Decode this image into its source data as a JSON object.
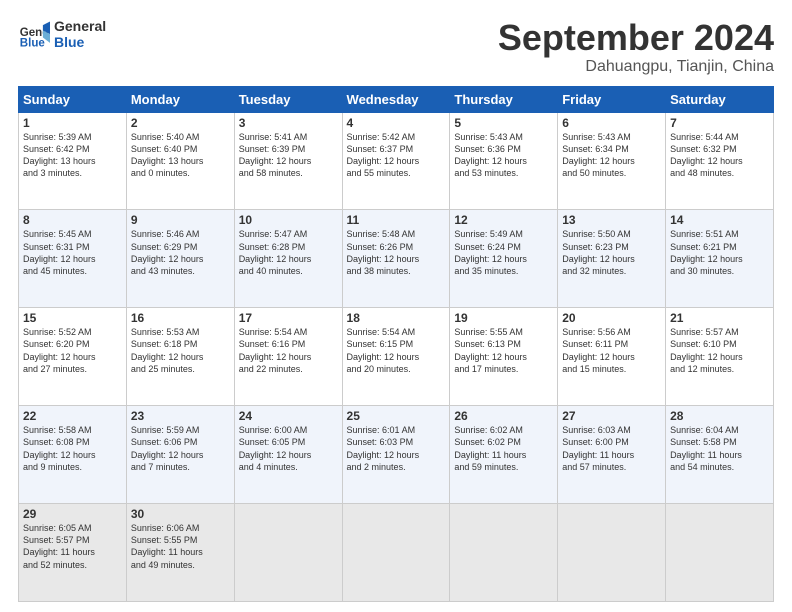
{
  "logo": {
    "line1": "General",
    "line2": "Blue"
  },
  "title": "September 2024",
  "location": "Dahuangpu, Tianjin, China",
  "days_header": [
    "Sunday",
    "Monday",
    "Tuesday",
    "Wednesday",
    "Thursday",
    "Friday",
    "Saturday"
  ],
  "weeks": [
    [
      {
        "day": "1",
        "info": "Sunrise: 5:39 AM\nSunset: 6:42 PM\nDaylight: 13 hours\nand 3 minutes."
      },
      {
        "day": "2",
        "info": "Sunrise: 5:40 AM\nSunset: 6:40 PM\nDaylight: 13 hours\nand 0 minutes."
      },
      {
        "day": "3",
        "info": "Sunrise: 5:41 AM\nSunset: 6:39 PM\nDaylight: 12 hours\nand 58 minutes."
      },
      {
        "day": "4",
        "info": "Sunrise: 5:42 AM\nSunset: 6:37 PM\nDaylight: 12 hours\nand 55 minutes."
      },
      {
        "day": "5",
        "info": "Sunrise: 5:43 AM\nSunset: 6:36 PM\nDaylight: 12 hours\nand 53 minutes."
      },
      {
        "day": "6",
        "info": "Sunrise: 5:43 AM\nSunset: 6:34 PM\nDaylight: 12 hours\nand 50 minutes."
      },
      {
        "day": "7",
        "info": "Sunrise: 5:44 AM\nSunset: 6:32 PM\nDaylight: 12 hours\nand 48 minutes."
      }
    ],
    [
      {
        "day": "8",
        "info": "Sunrise: 5:45 AM\nSunset: 6:31 PM\nDaylight: 12 hours\nand 45 minutes."
      },
      {
        "day": "9",
        "info": "Sunrise: 5:46 AM\nSunset: 6:29 PM\nDaylight: 12 hours\nand 43 minutes."
      },
      {
        "day": "10",
        "info": "Sunrise: 5:47 AM\nSunset: 6:28 PM\nDaylight: 12 hours\nand 40 minutes."
      },
      {
        "day": "11",
        "info": "Sunrise: 5:48 AM\nSunset: 6:26 PM\nDaylight: 12 hours\nand 38 minutes."
      },
      {
        "day": "12",
        "info": "Sunrise: 5:49 AM\nSunset: 6:24 PM\nDaylight: 12 hours\nand 35 minutes."
      },
      {
        "day": "13",
        "info": "Sunrise: 5:50 AM\nSunset: 6:23 PM\nDaylight: 12 hours\nand 32 minutes."
      },
      {
        "day": "14",
        "info": "Sunrise: 5:51 AM\nSunset: 6:21 PM\nDaylight: 12 hours\nand 30 minutes."
      }
    ],
    [
      {
        "day": "15",
        "info": "Sunrise: 5:52 AM\nSunset: 6:20 PM\nDaylight: 12 hours\nand 27 minutes."
      },
      {
        "day": "16",
        "info": "Sunrise: 5:53 AM\nSunset: 6:18 PM\nDaylight: 12 hours\nand 25 minutes."
      },
      {
        "day": "17",
        "info": "Sunrise: 5:54 AM\nSunset: 6:16 PM\nDaylight: 12 hours\nand 22 minutes."
      },
      {
        "day": "18",
        "info": "Sunrise: 5:54 AM\nSunset: 6:15 PM\nDaylight: 12 hours\nand 20 minutes."
      },
      {
        "day": "19",
        "info": "Sunrise: 5:55 AM\nSunset: 6:13 PM\nDaylight: 12 hours\nand 17 minutes."
      },
      {
        "day": "20",
        "info": "Sunrise: 5:56 AM\nSunset: 6:11 PM\nDaylight: 12 hours\nand 15 minutes."
      },
      {
        "day": "21",
        "info": "Sunrise: 5:57 AM\nSunset: 6:10 PM\nDaylight: 12 hours\nand 12 minutes."
      }
    ],
    [
      {
        "day": "22",
        "info": "Sunrise: 5:58 AM\nSunset: 6:08 PM\nDaylight: 12 hours\nand 9 minutes."
      },
      {
        "day": "23",
        "info": "Sunrise: 5:59 AM\nSunset: 6:06 PM\nDaylight: 12 hours\nand 7 minutes."
      },
      {
        "day": "24",
        "info": "Sunrise: 6:00 AM\nSunset: 6:05 PM\nDaylight: 12 hours\nand 4 minutes."
      },
      {
        "day": "25",
        "info": "Sunrise: 6:01 AM\nSunset: 6:03 PM\nDaylight: 12 hours\nand 2 minutes."
      },
      {
        "day": "26",
        "info": "Sunrise: 6:02 AM\nSunset: 6:02 PM\nDaylight: 11 hours\nand 59 minutes."
      },
      {
        "day": "27",
        "info": "Sunrise: 6:03 AM\nSunset: 6:00 PM\nDaylight: 11 hours\nand 57 minutes."
      },
      {
        "day": "28",
        "info": "Sunrise: 6:04 AM\nSunset: 5:58 PM\nDaylight: 11 hours\nand 54 minutes."
      }
    ],
    [
      {
        "day": "29",
        "info": "Sunrise: 6:05 AM\nSunset: 5:57 PM\nDaylight: 11 hours\nand 52 minutes."
      },
      {
        "day": "30",
        "info": "Sunrise: 6:06 AM\nSunset: 5:55 PM\nDaylight: 11 hours\nand 49 minutes."
      },
      null,
      null,
      null,
      null,
      null
    ]
  ]
}
